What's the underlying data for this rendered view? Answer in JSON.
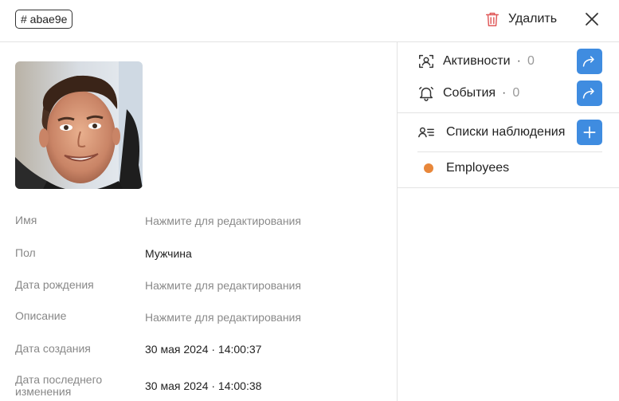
{
  "header": {
    "id_badge": "# abae9e",
    "delete_label": "Удалить",
    "delete_icon": "trash-icon",
    "close_icon": "close-icon",
    "accent_delete": "#e05a5a"
  },
  "fields": [
    {
      "label": "Имя",
      "value": "Нажмите для редактирования",
      "is_placeholder": true
    },
    {
      "label": "Пол",
      "value": "Мужчина",
      "is_placeholder": false
    },
    {
      "label": "Дата рождения",
      "value": "Нажмите для редактирования",
      "is_placeholder": true
    },
    {
      "label": "Описание",
      "value": "Нажмите для редактирования",
      "is_placeholder": true
    },
    {
      "label": "Дата создания",
      "value": "30 мая 2024 · 14:00:37",
      "is_placeholder": false
    },
    {
      "label": "Дата последнего изменения",
      "value": "30 мая 2024 · 14:00:38",
      "is_placeholder": false
    }
  ],
  "sidebar": {
    "activities": {
      "label": "Активности",
      "dot": "·",
      "count": "0",
      "icon": "face-scan-icon"
    },
    "events": {
      "label": "События",
      "dot": "·",
      "count": "0",
      "icon": "bell-icon"
    },
    "watchlists": {
      "label": "Списки наблюдения",
      "icon": "user-list-icon"
    },
    "watch_items": [
      {
        "label": "Employees",
        "color": "#e8873a"
      }
    ],
    "accent": "#3f8ce0"
  }
}
